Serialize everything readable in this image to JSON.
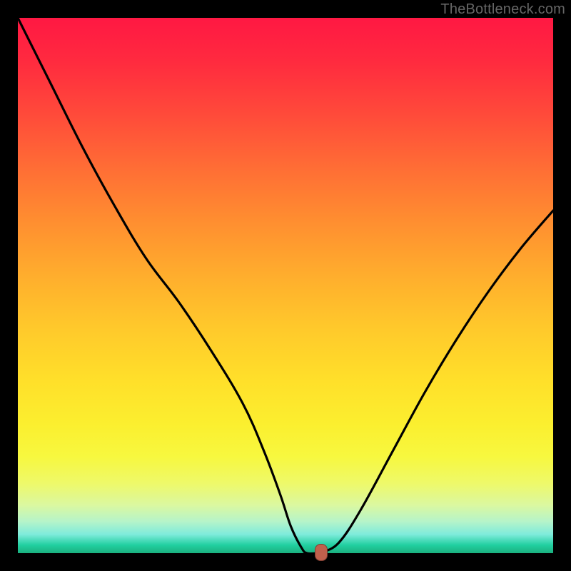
{
  "watermark": "TheBottleneck.com",
  "colors": {
    "page_bg": "#000000",
    "curve": "#000000",
    "marker": "#c0604c",
    "gradient_top": "#ff1843",
    "gradient_bottom": "#1bb07e"
  },
  "chart_data": {
    "type": "line",
    "title": "",
    "xlabel": "",
    "ylabel": "",
    "xlim": [
      0,
      100
    ],
    "ylim": [
      0,
      100
    ],
    "grid": false,
    "legend": false,
    "series": [
      {
        "name": "curve",
        "x": [
          0,
          6,
          12,
          18,
          24,
          30,
          36,
          42,
          46,
          49,
          51,
          53,
          54,
          56,
          57,
          60,
          64,
          70,
          76,
          82,
          88,
          94,
          100
        ],
        "y": [
          100,
          88,
          76,
          65,
          55,
          47,
          38,
          28,
          19,
          11,
          5,
          1,
          0,
          0,
          0.2,
          2,
          8,
          19,
          30,
          40,
          49,
          57,
          64
        ]
      }
    ],
    "marker": {
      "x": 56.5,
      "y": 0.3
    },
    "notes": "Axes have no visible tick labels; values are normalized 0–100 read from gridless plot."
  }
}
